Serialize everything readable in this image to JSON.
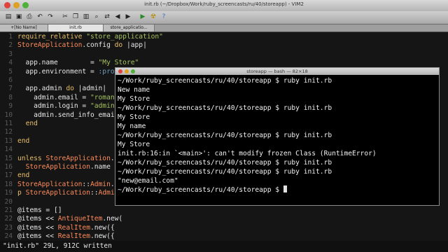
{
  "window": {
    "title": "init.rb (~/Dropbox/Work/ruby_screencasts/ru/40/storeapp) - VIM2"
  },
  "tabs": [
    {
      "label": "+[No Name]",
      "active": false
    },
    {
      "label": "init.rb",
      "active": true
    },
    {
      "label": "store_applicatio...",
      "active": false
    }
  ],
  "toolbar": {
    "icons": [
      "open-icon",
      "save-icon",
      "print-icon",
      "undo-icon",
      "redo-icon",
      "cut-icon",
      "copy-icon",
      "paste-icon",
      "find-icon",
      "replace-icon",
      "back-icon",
      "forward-icon",
      "run-icon",
      "hazard-icon",
      "help-icon"
    ]
  },
  "editor": {
    "lines": [
      {
        "n": "1",
        "text": "require_relative \"store_application\""
      },
      {
        "n": "2",
        "text": "StoreApplication.config do |app|"
      },
      {
        "n": "3",
        "text": ""
      },
      {
        "n": "4",
        "text": "  app.name        = \"My Store\""
      },
      {
        "n": "5",
        "text": "  app.environment = :produ"
      },
      {
        "n": "6",
        "text": ""
      },
      {
        "n": "7",
        "text": "  app.admin do |admin|"
      },
      {
        "n": "8",
        "text": "    admin.email = \"roman.s"
      },
      {
        "n": "9",
        "text": "    admin.login = \"admin\""
      },
      {
        "n": "10",
        "text": "    admin.send_info_emails"
      },
      {
        "n": "11",
        "text": "  end"
      },
      {
        "n": "12",
        "text": ""
      },
      {
        "n": "13",
        "text": "end"
      },
      {
        "n": "14",
        "text": ""
      },
      {
        "n": "15",
        "text": "unless StoreApplication.fr"
      },
      {
        "n": "16",
        "text": "  StoreApplication.name = "
      },
      {
        "n": "17",
        "text": "end"
      },
      {
        "n": "18",
        "text": "StoreApplication::Admin.em"
      },
      {
        "n": "19",
        "text": "p StoreApplication::Admin."
      },
      {
        "n": "20",
        "text": ""
      },
      {
        "n": "21",
        "text": "@items = []"
      },
      {
        "n": "22",
        "text": "@items << AntiqueItem.new("
      },
      {
        "n": "23",
        "text": "@items << RealItem.new({"
      },
      {
        "n": "24",
        "text": "@items << RealItem.new({"
      }
    ],
    "status": "\"init.rb\" 29L, 912C written"
  },
  "terminal": {
    "title": "storeapp — bash — 82×18",
    "lines": [
      "~/Work/ruby_screencasts/ru/40/storeapp $ ruby init.rb",
      "New name",
      "My Store",
      "~/Work/ruby_screencasts/ru/40/storeapp $ ruby init.rb",
      "My Store",
      "My name",
      "~/Work/ruby_screencasts/ru/40/storeapp $ ruby init.rb",
      "My Store",
      "init.rb:16:in `<main>': can't modify frozen Class (RuntimeError)",
      "~/Work/ruby_screencasts/ru/40/storeapp $ ruby init.rb",
      "~/Work/ruby_screencasts/ru/40/storeapp $ ruby init.rb",
      "\"new@email.com\"",
      "~/Work/ruby_screencasts/ru/40/storeapp $ "
    ]
  },
  "colors": {
    "keyword": "#e8bf6a",
    "class": "#ff8c5a",
    "string": "#a5c261",
    "symbol": "#6d9cbe",
    "line_number": "#5b5b5b",
    "terminal_text": "#f2f2f2"
  }
}
